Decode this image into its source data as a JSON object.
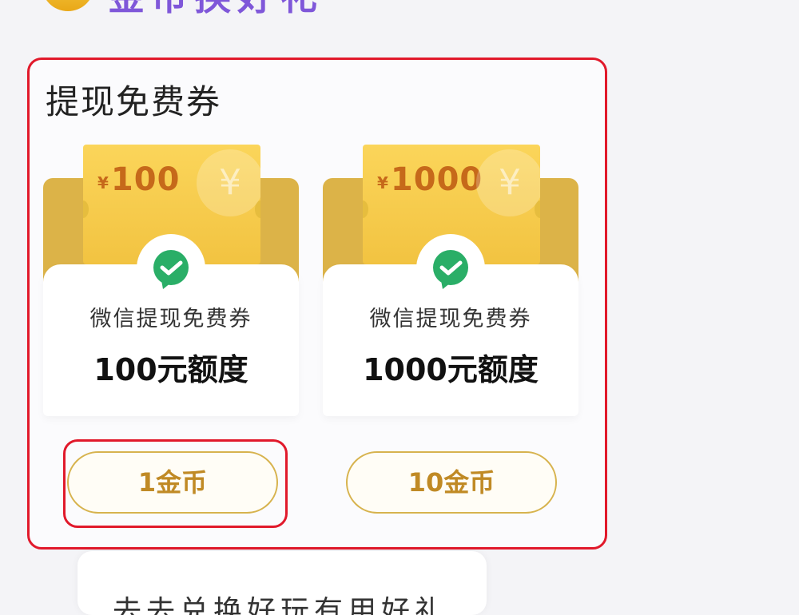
{
  "header": {
    "title": "金币换好礼",
    "coin_icon": "gold-coin-icon"
  },
  "panel": {
    "title": "提现免费券",
    "highlight_color": "#e1192b",
    "vouchers": [
      {
        "amount": "100",
        "currency_symbol": "¥",
        "subtitle": "微信提现免费券",
        "quota": "100元额度",
        "price": "1金币",
        "icon": "wechat-icon"
      },
      {
        "amount": "1000",
        "currency_symbol": "¥",
        "subtitle": "微信提现免费券",
        "quota": "1000元额度",
        "price": "10金币",
        "icon": "wechat-icon"
      }
    ]
  },
  "next_section": {
    "title": "去去兑换好玩有用好礼"
  }
}
